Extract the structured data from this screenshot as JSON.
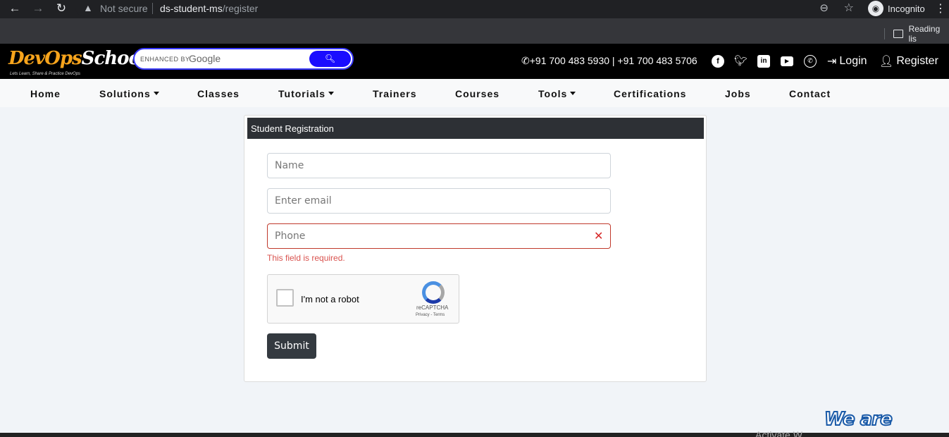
{
  "browser": {
    "security_text": "Not secure",
    "url_host": "ds-student-ms",
    "url_path": "/register",
    "profile_label": "Incognito",
    "reading_list_label": "Reading lis"
  },
  "header": {
    "logo_main": "DevOps",
    "logo_school": "School",
    "logo_tagline": "Lets Learn, Share & Practice DevOps",
    "search_enhanced": "ENHANCED BY",
    "search_google": "Google",
    "phones": "+91 700 483 5930 | +91 700 483 5706",
    "login_label": "Login",
    "register_label": "Register"
  },
  "nav": {
    "items": [
      {
        "label": "Home"
      },
      {
        "label": "Solutions"
      },
      {
        "label": "Classes"
      },
      {
        "label": "Tutorials"
      },
      {
        "label": "Trainers"
      },
      {
        "label": "Courses"
      },
      {
        "label": "Tools"
      },
      {
        "label": "Certifications"
      },
      {
        "label": "Jobs"
      },
      {
        "label": "Contact"
      }
    ]
  },
  "form": {
    "title": "Student Registration",
    "name_placeholder": "Name",
    "email_placeholder": "Enter email",
    "phone_placeholder": "Phone",
    "phone_error": "This field is required.",
    "captcha_label": "I'm not a robot",
    "captcha_brand": "reCAPTCHA",
    "captcha_links": "Privacy - Terms",
    "submit_label": "Submit"
  },
  "footer": {
    "activate_text": "Activate W",
    "badge_text": "We are"
  },
  "colors": {
    "header_bg": "#000000",
    "card_header_bg": "#2d3035",
    "error": "#d9534f",
    "search_button": "#1a0dff"
  }
}
